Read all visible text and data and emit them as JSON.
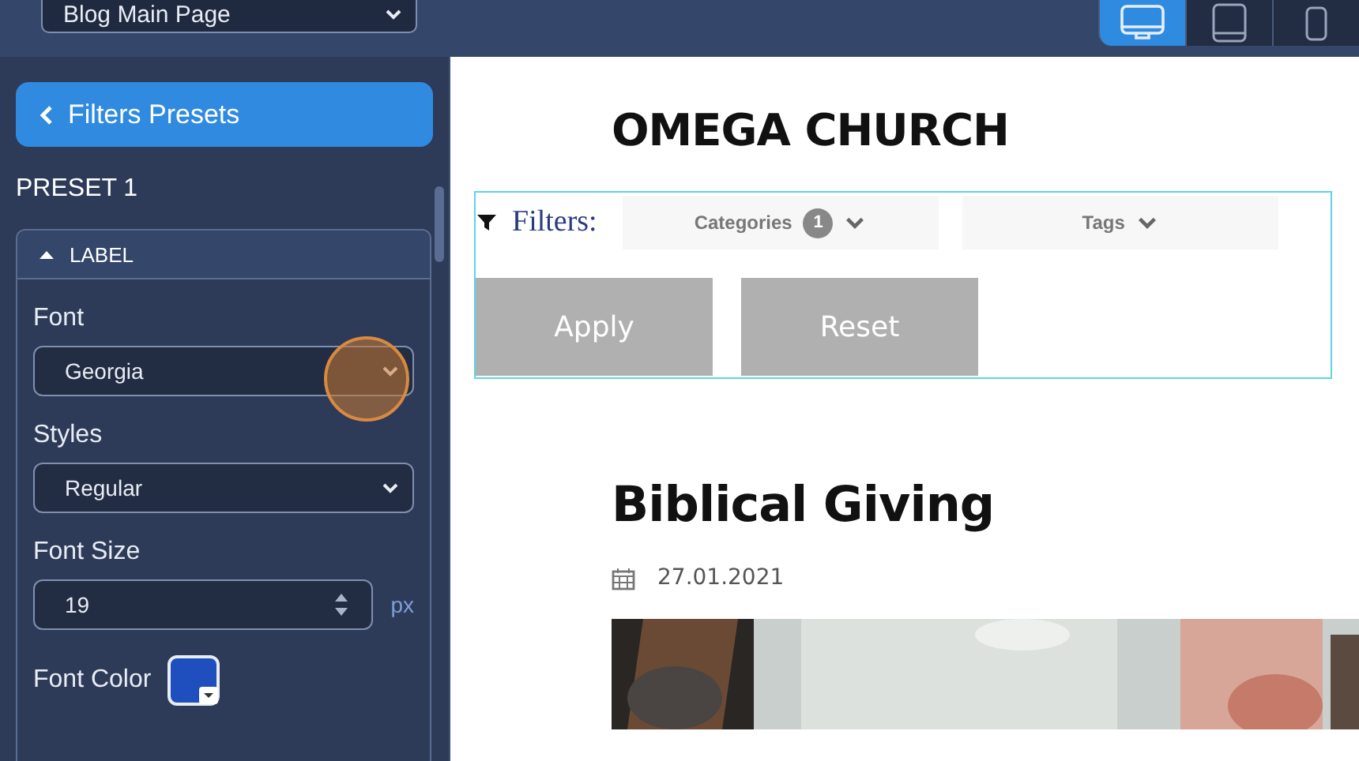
{
  "topbar": {
    "page_select": {
      "value": "Blog Main Page"
    },
    "devices": [
      {
        "kind": "desktop",
        "selected": true
      },
      {
        "kind": "tablet",
        "selected": false
      },
      {
        "kind": "mobile",
        "selected": false
      }
    ]
  },
  "sidebar": {
    "back_button": {
      "label": "Filters Presets"
    },
    "heading": "PRESET 1",
    "section": {
      "title": "LABEL",
      "expanded": true,
      "fields": [
        {
          "kind": "select",
          "label": "Font",
          "value": "Georgia"
        },
        {
          "kind": "select",
          "label": "Styles",
          "value": "Regular"
        },
        {
          "kind": "number",
          "label": "Font Size",
          "value": "19",
          "unit": "px"
        },
        {
          "kind": "color",
          "label": "Font Color",
          "color": "#1f4fbf"
        }
      ]
    }
  },
  "preview": {
    "site_title": "OMEGA CHURCH",
    "filters": {
      "label": "Filters:",
      "dropdowns": [
        {
          "label": "Categories",
          "count": "1"
        },
        {
          "label": "Tags"
        }
      ],
      "buttons": [
        "Apply",
        "Reset"
      ]
    },
    "post": {
      "title": "Biblical Giving",
      "date": "27.01.2021"
    }
  }
}
